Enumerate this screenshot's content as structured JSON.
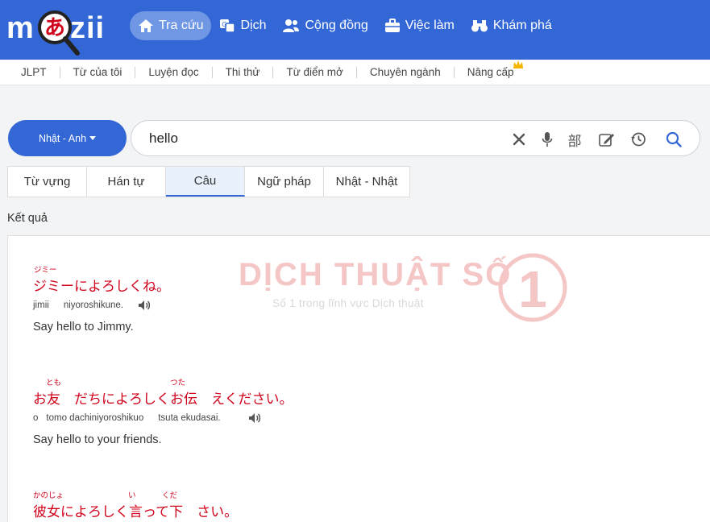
{
  "app": {
    "logo_left": "m",
    "logo_kana": "あ",
    "logo_right": "zii",
    "brand_color": "#3367d6",
    "accent_red": "#d0021b"
  },
  "nav": {
    "items": [
      {
        "label": "Tra cứu",
        "icon": "home-icon",
        "active": true
      },
      {
        "label": "Dịch",
        "icon": "translate-icon"
      },
      {
        "label": "Cộng đồng",
        "icon": "users-icon"
      },
      {
        "label": "Việc làm",
        "icon": "briefcase-icon"
      },
      {
        "label": "Khám phá",
        "icon": "binoculars-icon"
      }
    ]
  },
  "subnav": {
    "items": [
      "JLPT",
      "Từ của tôi",
      "Luyện đọc",
      "Thi thử",
      "Từ điển mở",
      "Chuyên ngành",
      "Nâng cấp"
    ]
  },
  "search": {
    "lang_label": "Nhật - Anh",
    "query": "hello",
    "radical_glyph": "部",
    "icons": [
      "clear-icon",
      "microphone-icon",
      "radical-icon",
      "handwrite-icon",
      "history-icon",
      "search-icon"
    ]
  },
  "tabs": {
    "items": [
      "Từ vựng",
      "Hán tự",
      "Câu",
      "Ngữ pháp",
      "Nhật - Nhật"
    ],
    "active": "Câu"
  },
  "results": {
    "label": "Kết quả",
    "watermark_title": "DỊCH THUẬT SỐ",
    "watermark_sub": "Số 1 trong lĩnh vực Dịch thuật",
    "watermark_number": "1",
    "examples": [
      {
        "jp": "ジミーによろしくね。",
        "furi": "ジミー",
        "romaji": [
          "jimii",
          "niyoroshikune."
        ],
        "meaning": "Say hello to Jimmy."
      },
      {
        "jp_parts": [
          "お",
          "友",
          "　だちによろしくお",
          "伝",
          "　えください。"
        ],
        "furi": [
          "とも",
          "つた"
        ],
        "romaji": [
          "o",
          "tomo dachiniyoroshikuo",
          "tsuta ekudasai."
        ],
        "meaning": "Say hello to your friends."
      },
      {
        "jp_parts": [
          "彼女",
          "によろしく",
          "言",
          "って",
          "下",
          "　さい。"
        ],
        "furi": [
          "かのじょ",
          "い",
          "くだ"
        ]
      }
    ]
  }
}
